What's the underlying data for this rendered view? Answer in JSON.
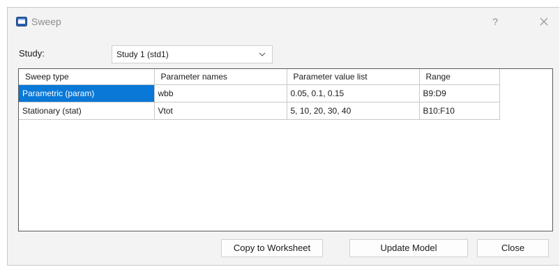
{
  "window": {
    "title": "Sweep",
    "help_glyph": "?",
    "icons": {
      "app": "app-window-icon",
      "close": "close-icon"
    },
    "colors": {
      "selection": "#0a78d7",
      "app_icon": "#2a5fb0"
    }
  },
  "study": {
    "label": "Study:",
    "selected": "Study 1 (std1)"
  },
  "grid": {
    "columns": [
      "Sweep type",
      "Parameter names",
      "Parameter value list",
      "Range"
    ],
    "rows": [
      {
        "sweep_type": "Parametric (param)",
        "parameter_names": "wbb",
        "value_list": "0.05, 0.1, 0.15",
        "range": "B9:D9",
        "selected": true
      },
      {
        "sweep_type": "Stationary (stat)",
        "parameter_names": "Vtot",
        "value_list": "5, 10, 20, 30, 40",
        "range": "B10:F10",
        "selected": false
      }
    ]
  },
  "buttons": {
    "copy_to_worksheet": "Copy to Worksheet",
    "update_model": "Update Model",
    "close": "Close"
  }
}
